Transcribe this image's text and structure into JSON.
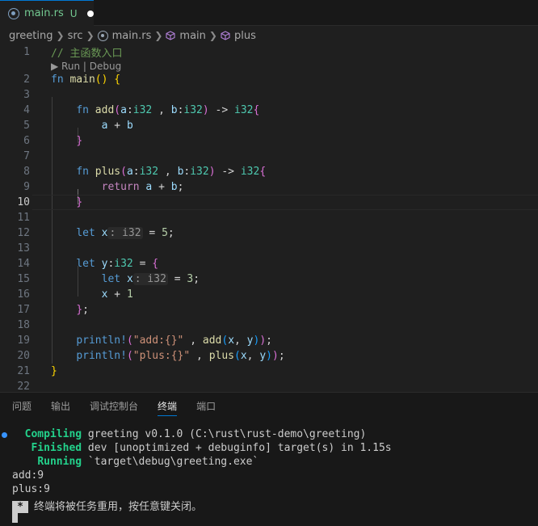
{
  "tab": {
    "label": "main.rs",
    "badge": "U"
  },
  "breadcrumb": {
    "folder": "greeting",
    "src": "src",
    "file": "main.rs",
    "fn1": "main",
    "fn2": "plus"
  },
  "editor": {
    "codelens": "▶ Run | Debug",
    "active_line": 10,
    "line_numbers": [
      "1",
      "2",
      "3",
      "4",
      "5",
      "6",
      "7",
      "8",
      "9",
      "10",
      "11",
      "12",
      "13",
      "14",
      "15",
      "16",
      "17",
      "18",
      "19",
      "20",
      "21",
      "22"
    ],
    "comment": "// 主函数入口",
    "t": {
      "fn": "fn",
      "main": "main",
      "paren_open": "(",
      "paren_close": ")",
      "brace_open": "{",
      "brace_close": "}",
      "add": "add",
      "plus": "plus",
      "a": "a",
      "b": "b",
      "x": "x",
      "y": "y",
      "i32": "i32",
      "colon": ":",
      "comma_sp": " , ",
      "arrow": " -> ",
      "plus_op": " + ",
      "return": "return",
      "let": "let",
      "eq": " = ",
      "semi": ";",
      "five": "5",
      "three": "3",
      "one": "1",
      "println": "println!",
      "str_add": "\"add:{}\"",
      "str_plus": "\"plus:{}\"",
      "hint_i32": "i32",
      "closing": "};"
    }
  },
  "panel": {
    "tabs": [
      "问题",
      "输出",
      "调试控制台",
      "终端",
      "端口"
    ],
    "active_tab": "终端",
    "terminal": {
      "l1_label": "Compiling",
      "l1_text": " greeting v0.1.0 (C:\\rust\\rust-demo\\greeting)",
      "l2_label": "Finished",
      "l2_text": " dev [unoptimized + debuginfo] target(s) in 1.15s",
      "l3_label": "Running",
      "l3_text": " `target\\debug\\greeting.exe`",
      "l4": "add:9",
      "l5": "plus:9",
      "l6_star": "*",
      "l6_text": "终端将被任务重用，按任意键关闭。"
    }
  }
}
